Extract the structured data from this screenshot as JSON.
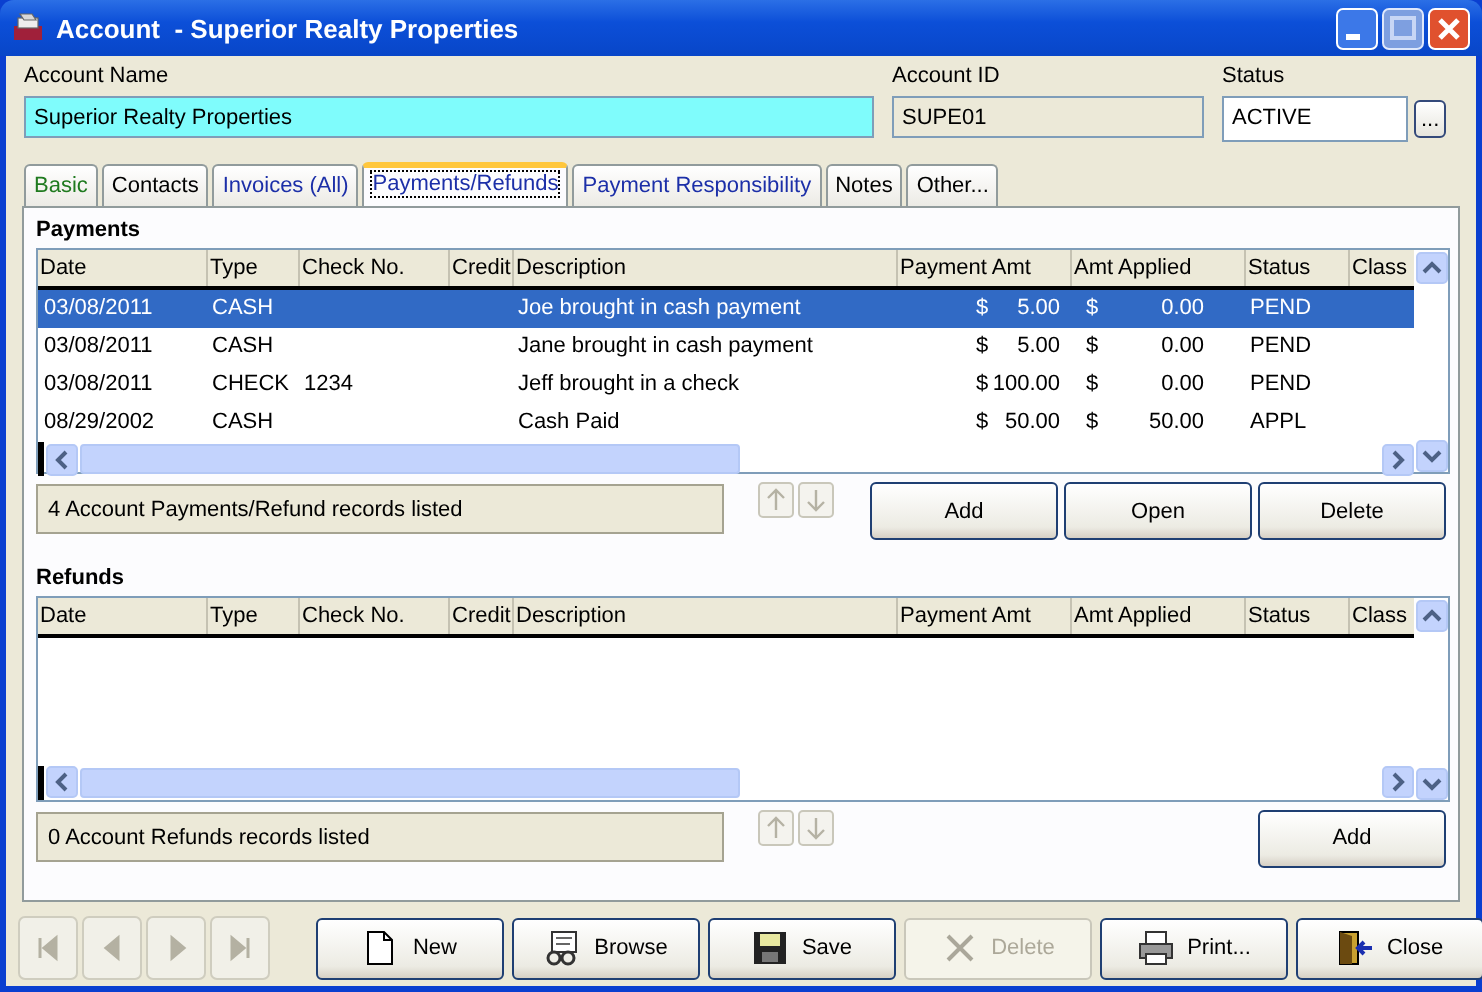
{
  "window": {
    "title": "Account  - Superior Realty Properties"
  },
  "header": {
    "account_name_label": "Account Name",
    "account_name": "Superior Realty Properties",
    "account_id_label": "Account ID",
    "account_id": "SUPE01",
    "status_label": "Status",
    "status": "ACTIVE",
    "lookup_button": "..."
  },
  "tabs": [
    {
      "label": "Basic",
      "selected": false,
      "color": "#1f7a1f"
    },
    {
      "label": "Contacts",
      "selected": false,
      "color": "#000000"
    },
    {
      "label": "Invoices (All)",
      "selected": false,
      "color": "#1c2fa8"
    },
    {
      "label": "Payments/Refunds",
      "selected": true,
      "color": "#1c2fa8"
    },
    {
      "label": "Payment Responsibility",
      "selected": false,
      "color": "#1c2fa8"
    },
    {
      "label": "Notes",
      "selected": false,
      "color": "#000000"
    },
    {
      "label": "Other...",
      "selected": false,
      "color": "#000000"
    }
  ],
  "sections": [
    {
      "title": "Payments",
      "columns": [
        "Date",
        "Type",
        "Check No.",
        "Credit",
        "Description",
        "Payment Amt",
        "Amt Applied",
        "Status",
        "Class"
      ],
      "rows": [
        {
          "selected": true,
          "date": "03/08/2011",
          "type": "CASH",
          "check_no": "",
          "description": "Joe brought in cash payment",
          "payment_currency": "$",
          "payment_amt": "5.00",
          "applied_currency": "$",
          "amt_applied": "0.00",
          "status": "PEND"
        },
        {
          "selected": false,
          "date": "03/08/2011",
          "type": "CASH",
          "check_no": "",
          "description": "Jane brought in cash payment",
          "payment_currency": "$",
          "payment_amt": "5.00",
          "applied_currency": "$",
          "amt_applied": "0.00",
          "status": "PEND"
        },
        {
          "selected": false,
          "date": "03/08/2011",
          "type": "CHECK",
          "check_no": "1234",
          "description": "Jeff brought in a check",
          "payment_currency": "$",
          "payment_amt": "100.00",
          "applied_currency": "$",
          "amt_applied": "0.00",
          "status": "PEND"
        },
        {
          "selected": false,
          "date": "08/29/2002",
          "type": "CASH",
          "check_no": "",
          "description": "Cash Paid",
          "payment_currency": "$",
          "payment_amt": "50.00",
          "applied_currency": "$",
          "amt_applied": "50.00",
          "status": "APPL"
        }
      ],
      "count_text": "4 Account Payments/Refund records listed",
      "buttons": [
        "Add",
        "Open",
        "Delete"
      ]
    },
    {
      "title": "Refunds",
      "columns": [
        "Date",
        "Type",
        "Check No.",
        "Credit",
        "Description",
        "Payment Amt",
        "Amt Applied",
        "Status",
        "Class"
      ],
      "count_text": "0 Account Refunds records listed",
      "buttons": [
        "Add"
      ]
    }
  ],
  "toolbar": [
    {
      "label": "New",
      "kind": "new",
      "disabled": false
    },
    {
      "label": "Browse",
      "kind": "browse",
      "disabled": false
    },
    {
      "label": "Save",
      "kind": "save",
      "disabled": false
    },
    {
      "label": "Delete",
      "kind": "delete",
      "disabled": true
    },
    {
      "label": "Print...",
      "kind": "print",
      "disabled": false
    },
    {
      "label": "Close",
      "kind": "close",
      "disabled": false
    }
  ]
}
